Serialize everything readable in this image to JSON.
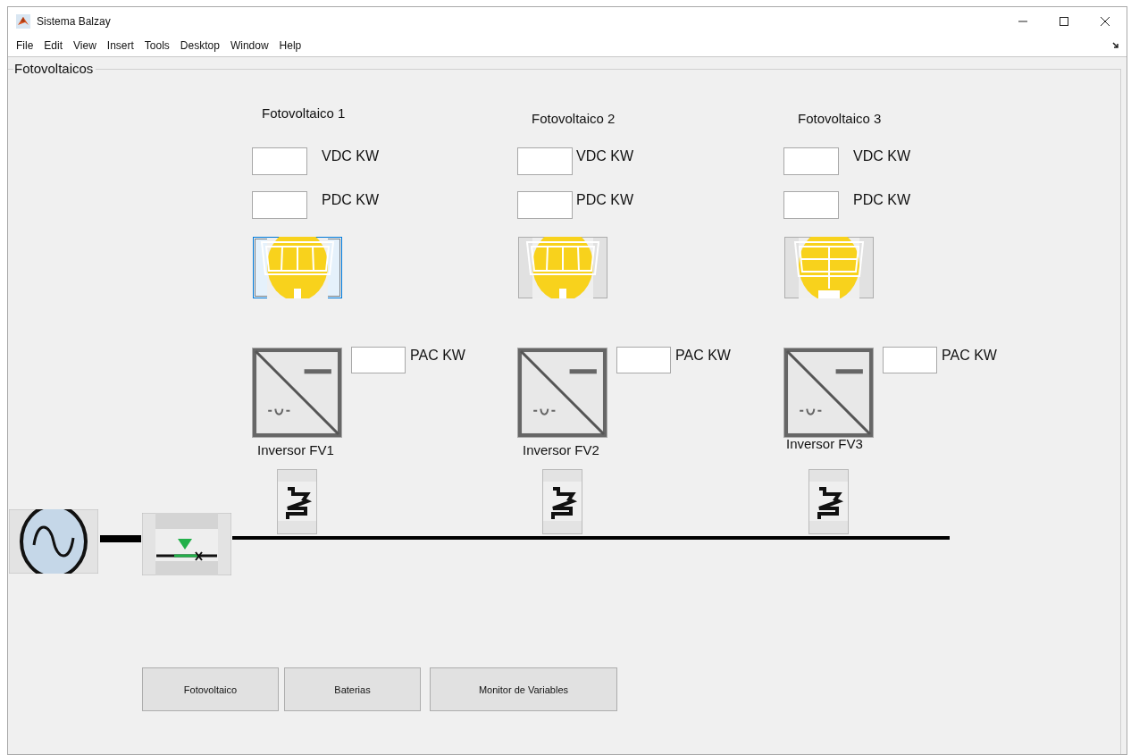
{
  "window": {
    "title": "Sistema Balzay"
  },
  "menu": [
    "File",
    "Edit",
    "View",
    "Insert",
    "Tools",
    "Desktop",
    "Window",
    "Help"
  ],
  "panel": {
    "title": "Fotovoltaicos",
    "units": [
      {
        "title": "Fotovoltaico 1",
        "vdc_label": "VDC KW",
        "pdc_label": "PDC KW",
        "pac_label": "PAC KW",
        "inverter_label": "Inversor FV1",
        "kind": "strips",
        "selected": true
      },
      {
        "title": "Fotovoltaico 2",
        "vdc_label": "VDC KW",
        "pdc_label": "PDC KW",
        "pac_label": "PAC KW",
        "inverter_label": "Inversor FV2",
        "kind": "strips",
        "selected": false
      },
      {
        "title": "Fotovoltaico 3",
        "vdc_label": "VDC KW",
        "pdc_label": "PDC KW",
        "pac_label": "PAC KW",
        "inverter_label": "Inversor FV3",
        "kind": "grid",
        "selected": false
      }
    ]
  },
  "buttons": [
    "Fotovoltaico",
    "Baterias",
    "Monitor de Variables"
  ]
}
